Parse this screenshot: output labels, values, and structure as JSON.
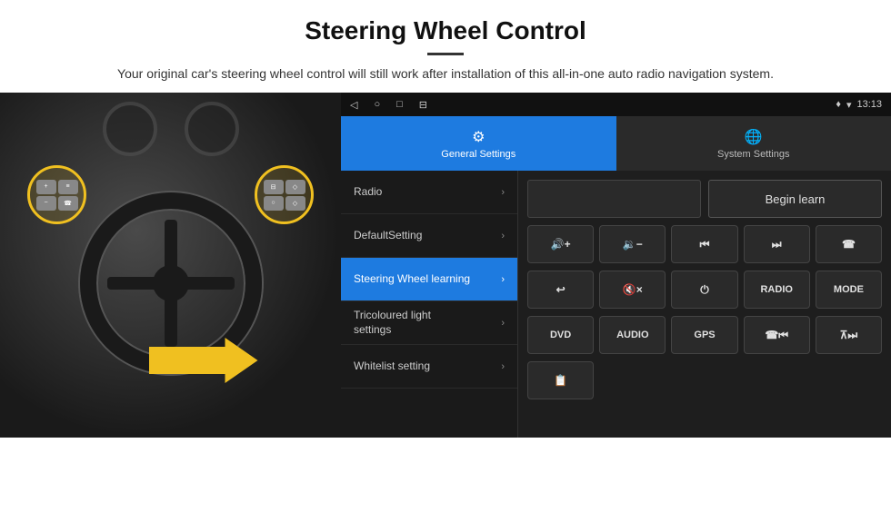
{
  "header": {
    "title": "Steering Wheel Control",
    "description": "Your original car's steering wheel control will still work after installation of this all-in-one auto radio navigation system."
  },
  "statusBar": {
    "navButtons": [
      "◁",
      "○",
      "□",
      "⊟"
    ],
    "gpsIcon": "♦",
    "wifiIcon": "▾",
    "time": "13:13"
  },
  "tabs": [
    {
      "label": "General Settings",
      "icon": "⚙",
      "active": true
    },
    {
      "label": "System Settings",
      "icon": "🌐",
      "active": false
    }
  ],
  "menuItems": [
    {
      "label": "Radio",
      "active": false
    },
    {
      "label": "DefaultSetting",
      "active": false
    },
    {
      "label": "Steering Wheel learning",
      "active": true
    },
    {
      "label": "Tricoloured light settings",
      "active": false
    },
    {
      "label": "Whitelist setting",
      "active": false
    }
  ],
  "rightPanel": {
    "beginLearnLabel": "Begin learn",
    "row1": [
      "◄+",
      "◄-",
      "◄◄",
      "►►",
      "☎"
    ],
    "row1Labels": [
      "vol+",
      "vol-",
      "prev",
      "next",
      "phone"
    ],
    "row2": [
      "↩",
      "🔇×",
      "⏻",
      "RADIO",
      "MODE"
    ],
    "row3": [
      "DVD",
      "AUDIO",
      "GPS",
      "☎◄◄",
      "⊼►►"
    ],
    "row4": [
      "📋"
    ]
  }
}
